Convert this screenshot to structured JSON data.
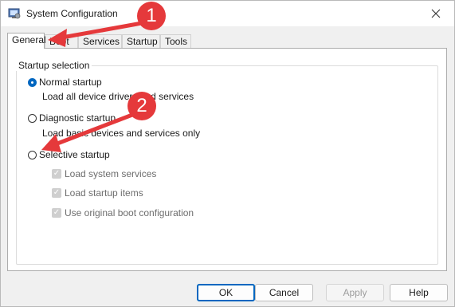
{
  "window": {
    "title": "System Configuration"
  },
  "tabs": [
    "General",
    "Boot",
    "Services",
    "Startup",
    "Tools"
  ],
  "group": {
    "legend": "Startup selection"
  },
  "options": {
    "normal": {
      "label": "Normal startup",
      "desc": "Load all device drivers and services"
    },
    "diagnostic": {
      "label": "Diagnostic startup",
      "desc": "Load basic devices and services only"
    },
    "selective": {
      "label": "Selective startup"
    }
  },
  "selective_items": [
    "Load system services",
    "Load startup items",
    "Use original boot configuration"
  ],
  "buttons": {
    "ok": "OK",
    "cancel": "Cancel",
    "apply": "Apply",
    "help": "Help"
  },
  "annotations": {
    "badge1": "1",
    "badge2": "2"
  },
  "colors": {
    "accent": "#0067c0",
    "annotation": "#e5393b"
  },
  "icons": {
    "close": "close-icon",
    "app": "msconfig-app-icon"
  }
}
